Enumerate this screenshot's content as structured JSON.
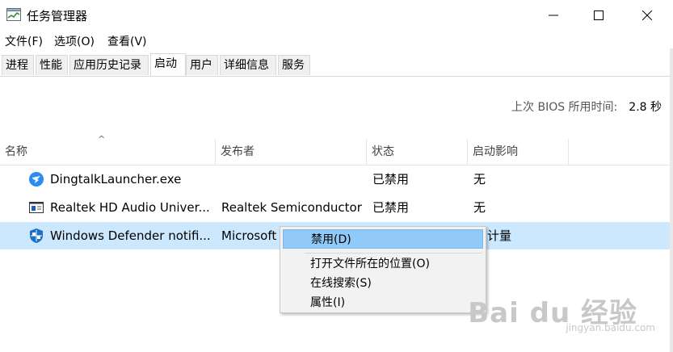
{
  "window": {
    "title": "任务管理器",
    "minimize_icon": "minimize-icon",
    "maximize_icon": "maximize-icon",
    "close_icon": "close-icon"
  },
  "menu": [
    "文件(F)",
    "选项(O)",
    "查看(V)"
  ],
  "tabs": [
    {
      "label": "进程",
      "active": false
    },
    {
      "label": "性能",
      "active": false
    },
    {
      "label": "应用历史记录",
      "active": false
    },
    {
      "label": "启动",
      "active": true
    },
    {
      "label": "用户",
      "active": false
    },
    {
      "label": "详细信息",
      "active": false
    },
    {
      "label": "服务",
      "active": false
    }
  ],
  "bios": {
    "label": "上次 BIOS 所用时间:",
    "value": "2.8 秒"
  },
  "columns": [
    "名称",
    "发布者",
    "状态",
    "启动影响"
  ],
  "sort_arrow": "^",
  "rows": [
    {
      "icon": "dingtalk-icon",
      "name": "DingtalkLauncher.exe",
      "publisher": "",
      "status": "已禁用",
      "impact": "无",
      "selected": false
    },
    {
      "icon": "realtek-audio-icon",
      "name": "Realtek HD Audio Univer...",
      "publisher": "Realtek Semiconductor",
      "status": "已禁用",
      "impact": "无",
      "selected": false
    },
    {
      "icon": "windows-defender-icon",
      "name": "Windows Defender notifi...",
      "publisher": "Microsoft",
      "status": "",
      "impact": "计量",
      "selected": true
    }
  ],
  "context_menu": {
    "items": [
      {
        "label": "禁用(D)",
        "highlighted": true
      },
      {
        "label": "打开文件所在的位置(O)",
        "highlighted": false
      },
      {
        "label": "在线搜索(S)",
        "highlighted": false
      },
      {
        "label": "属性(I)",
        "highlighted": false
      }
    ]
  },
  "watermark": {
    "text": "Bai du 经验",
    "sub": "jingyan.baidu.com"
  },
  "colors": {
    "selected_row": "#cce8ff",
    "menu_highlight": "#91c9f7",
    "defender_blue": "#1e6fc7",
    "dingtalk_blue": "#2d8cf0"
  }
}
